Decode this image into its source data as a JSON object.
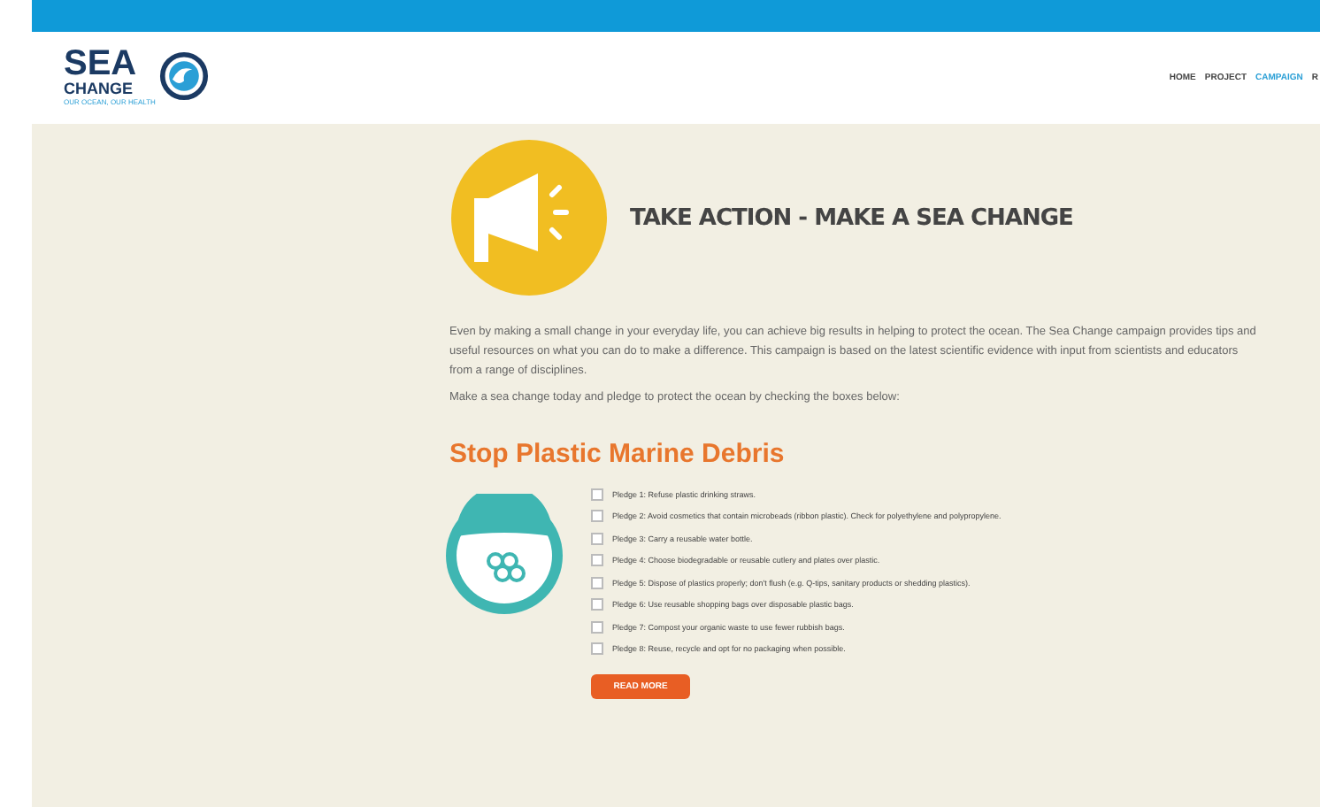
{
  "header": {
    "logo": {
      "name": "SEA",
      "name_line2": "CHANGE",
      "tagline": "OUR OCEAN, OUR HEALTH"
    },
    "nav": [
      {
        "label": "HOME",
        "selected": false
      },
      {
        "label": "PROJECT",
        "selected": false
      },
      {
        "label": "CAMPAIGN",
        "selected": true
      },
      {
        "label": "R",
        "selected": false
      }
    ]
  },
  "intro": {
    "title": "TAKE ACTION - MAKE A SEA CHANGE",
    "paragraphs": [
      "Even by making a small change in your everyday life, you can achieve big results in helping to protect the ocean. The Sea Change campaign provides tips and useful resources on what you can do to make a difference. This campaign is based on the latest scientific evidence with input from scientists and educators from a range of disciplines.",
      "Make a sea change today and pledge to protect the ocean by checking the boxes below:"
    ]
  },
  "section": {
    "heading": "Stop Plastic Marine Debris",
    "pledges": [
      {
        "text": "Pledge 1: Refuse plastic drinking straws.",
        "checked": false
      },
      {
        "text": "Pledge 2: Avoid cosmetics that contain microbeads (ribbon plastic). Check for polyethylene and polypropylene.",
        "checked": false
      },
      {
        "text": "Pledge 3: Carry a reusable water bottle.",
        "checked": false
      },
      {
        "text": "Pledge 4: Choose biodegradable or reusable cutlery and plates over plastic.",
        "checked": false
      },
      {
        "text": "Pledge 5: Dispose of plastics properly; don't flush (e.g. Q-tips, sanitary products or shedding plastics).",
        "checked": false
      },
      {
        "text": "Pledge 6: Use reusable shopping bags over disposable plastic bags.",
        "checked": false
      },
      {
        "text": "Pledge 7: Compost your organic waste to use fewer rubbish bags.",
        "checked": false
      },
      {
        "text": "Pledge 8: Reuse, recycle and opt for no packaging when possible.",
        "checked": false
      }
    ],
    "button": "READ MORE"
  }
}
